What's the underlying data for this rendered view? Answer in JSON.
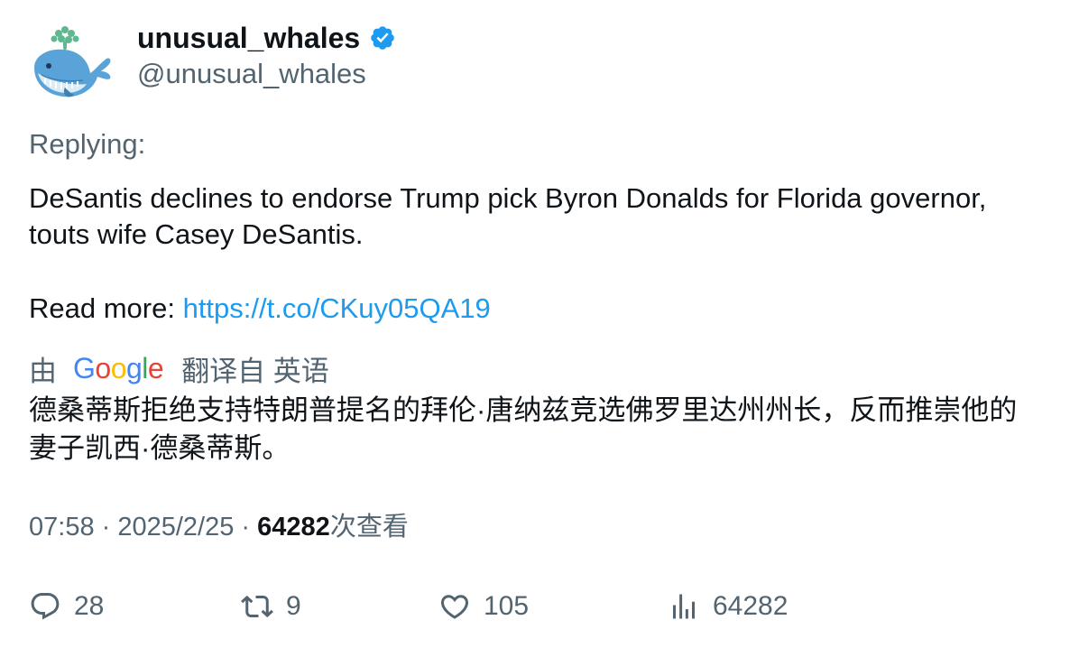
{
  "author": {
    "display_name": "unusual_whales",
    "handle": "@unusual_whales",
    "verified": true,
    "avatar_icon": "whale-avatar-icon",
    "verified_color": "#1d9bf0"
  },
  "tweet": {
    "replying_label": "Replying:",
    "text_line1": "DeSantis declines to endorse Trump pick Byron Donalds for Florida governor,",
    "text_line2": "touts wife Casey DeSantis.",
    "read_more_label": "Read more: ",
    "link": "https://t.co/CKuy05QA19"
  },
  "translation": {
    "by_label": "由",
    "google_letters": [
      "G",
      "o",
      "o",
      "g",
      "l",
      "e"
    ],
    "google_colors": [
      "#4285f4",
      "#ea4335",
      "#fbbc05",
      "#4285f4",
      "#34a853",
      "#ea4335"
    ],
    "translated_from": "翻译自 英语",
    "text_line1": "德桑蒂斯拒绝支持特朗普提名的拜伦·唐纳兹竞选佛罗里达州州长，反而推崇他的",
    "text_line2": "妻子凯西·德桑蒂斯。"
  },
  "meta": {
    "time": "07:58",
    "sep1": " · ",
    "date": "2025/2/25",
    "sep2": " · ",
    "views": "64282",
    "views_label": "次查看"
  },
  "actions": {
    "replies": "28",
    "retweets": "9",
    "likes": "105",
    "views": "64282"
  },
  "colors": {
    "link": "#1d9bf0",
    "secondary_text": "#536471",
    "primary_text": "#0f1419"
  }
}
